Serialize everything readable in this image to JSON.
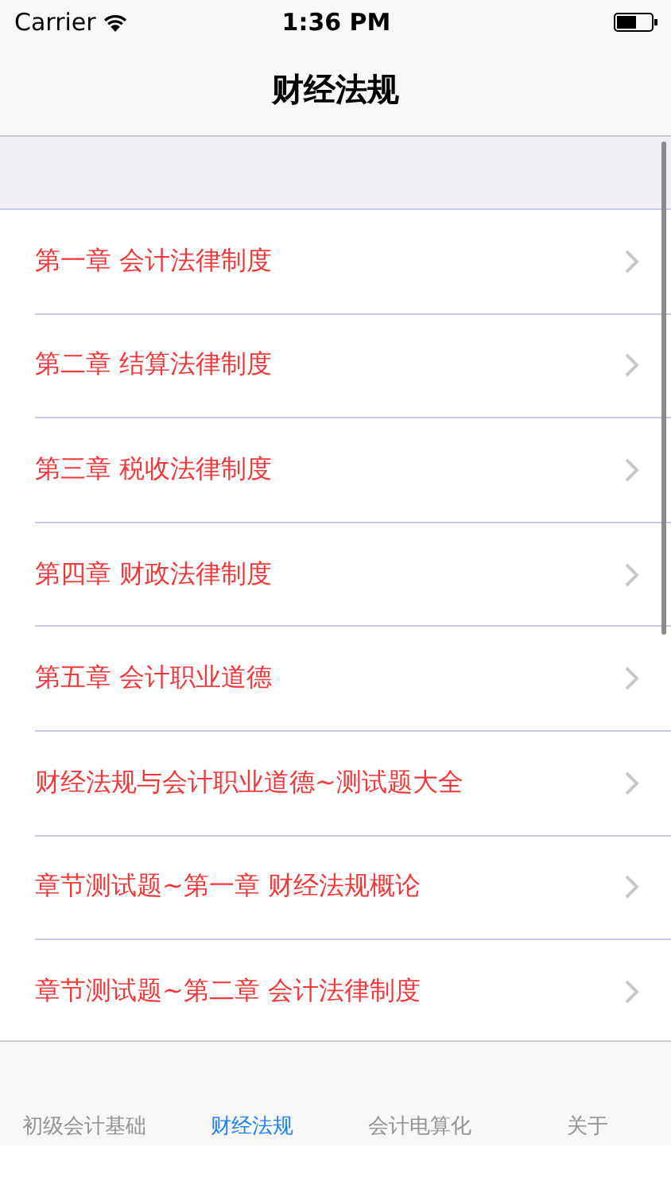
{
  "status_bar": {
    "carrier": "Carrier",
    "time": "1:36 PM"
  },
  "nav_bar": {
    "title": "财经法规"
  },
  "list": {
    "rows": [
      {
        "label": "第一章 会计法律制度"
      },
      {
        "label": "第二章 结算法律制度"
      },
      {
        "label": "第三章 税收法律制度"
      },
      {
        "label": "第四章 财政法律制度"
      },
      {
        "label": "第五章 会计职业道德"
      },
      {
        "label": "财经法规与会计职业道德~测试题大全"
      },
      {
        "label": "章节测试题~第一章 财经法规概论"
      },
      {
        "label": "章节测试题~第二章 会计法律制度"
      }
    ]
  },
  "tab_bar": {
    "tabs": [
      {
        "label": "初级会计基础",
        "selected": false
      },
      {
        "label": "财经法规",
        "selected": true
      },
      {
        "label": "会计电算化",
        "selected": false
      },
      {
        "label": "关于",
        "selected": false
      }
    ]
  }
}
